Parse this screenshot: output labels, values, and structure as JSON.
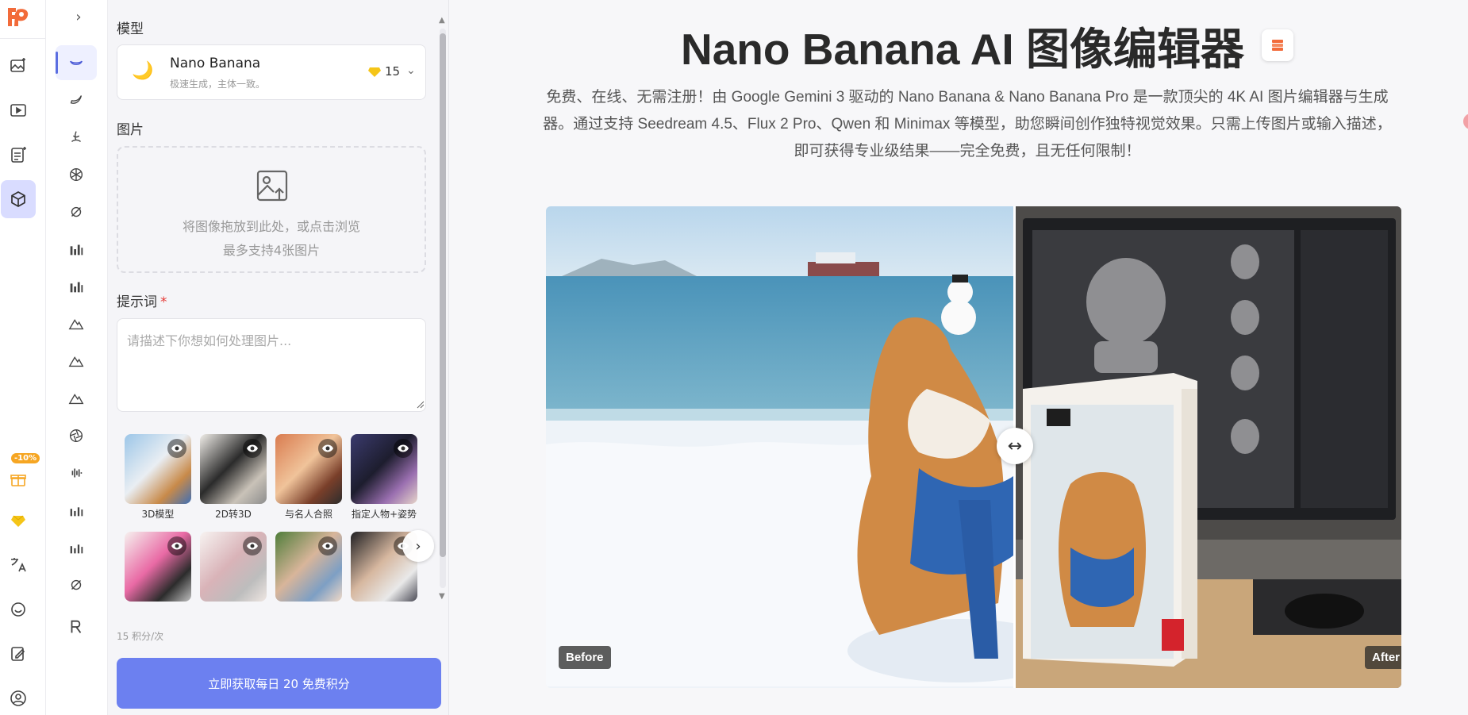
{
  "colors": {
    "accent": "#6c80f0",
    "brand": "#f26b3a",
    "active_rail": "#d9dcff",
    "discount_badge": "#f6a623",
    "coin": "#f5c518",
    "required": "#e53935"
  },
  "rail": {
    "items": [
      {
        "icon": "image-sparkle-icon"
      },
      {
        "icon": "video-play-icon"
      },
      {
        "icon": "document-sparkle-icon"
      },
      {
        "icon": "cube-3d-icon",
        "active": true
      }
    ],
    "bottom": [
      {
        "icon": "gift-icon",
        "badge": "-10%"
      },
      {
        "icon": "coin-icon"
      },
      {
        "icon": "translate-icon"
      },
      {
        "icon": "chat-support-icon"
      },
      {
        "icon": "edit-note-icon"
      },
      {
        "icon": "user-account-icon"
      }
    ]
  },
  "tools": {
    "collapse_icon": "chevron-right-icon",
    "items": [
      {
        "icon": "nano-banana-model-icon",
        "active": true
      },
      {
        "icon": "banana-icon"
      },
      {
        "icon": "seedream-icon"
      },
      {
        "icon": "openai-icon"
      },
      {
        "icon": "qwen-icon"
      },
      {
        "icon": "bars-chart-icon"
      },
      {
        "icon": "bars-chart-icon-2"
      },
      {
        "icon": "mountain-icon"
      },
      {
        "icon": "mountain-icon-2"
      },
      {
        "icon": "mountain-icon-3"
      },
      {
        "icon": "aperture-icon"
      },
      {
        "icon": "waveform-icon"
      },
      {
        "icon": "bars-chart-icon-3"
      },
      {
        "icon": "bars-chart-icon-4"
      },
      {
        "icon": "qwen-icon-2"
      },
      {
        "icon": "recraft-icon"
      }
    ]
  },
  "panel": {
    "model_label": "模型",
    "model": {
      "name": "Nano Banana",
      "desc": "极速生成，主体一致。",
      "cost": "15",
      "emoji": "🌙"
    },
    "image_label": "图片",
    "drop_line1": "将图像拖放到此处，或点击浏览",
    "drop_line2": "最多支持4张图片",
    "prompt_label": "提示词",
    "required_mark": "*",
    "prompt_placeholder": "请描述下你想如何处理图片...",
    "prompt_value": "",
    "presets": [
      {
        "caption": "3D模型",
        "palette": [
          "#9cc6e8",
          "#e9eef3",
          "#c88a4a",
          "#3f6fb5"
        ]
      },
      {
        "caption": "2D转3D",
        "palette": [
          "#f1eee9",
          "#2b2b2b",
          "#c9c2b8",
          "#8d8d8d"
        ]
      },
      {
        "caption": "与名人合照",
        "palette": [
          "#d97b4f",
          "#f0c39a",
          "#7a3f2a",
          "#2d2d2d"
        ]
      },
      {
        "caption": "指定人物+姿势",
        "palette": [
          "#3b3b6e",
          "#1d1d2e",
          "#9a6fb0",
          "#e7d5c9"
        ]
      },
      {
        "caption": "",
        "palette": [
          "#f6f2ef",
          "#e96aa5",
          "#2c2c2c",
          "#c0c0c0"
        ]
      },
      {
        "caption": "",
        "palette": [
          "#f7f3f1",
          "#d9b3b8",
          "#bdbdbd",
          "#efe6e2"
        ]
      },
      {
        "caption": "",
        "palette": [
          "#4f7d3a",
          "#d8b59a",
          "#7d9fc4",
          "#f1d9c7"
        ]
      },
      {
        "caption": "",
        "palette": [
          "#1f1f22",
          "#d6b79f",
          "#e9e9e9",
          "#4a4a55"
        ]
      }
    ],
    "credits_note": "15 积分/次",
    "cta_label": "立即获取每日 20 免费积分"
  },
  "main": {
    "title": "Nano Banana AI 图像编辑器",
    "description": "免费、在线、无需注册！由 Google Gemini 3 驱动的 Nano Banana & Nano Banana Pro 是一款顶尖的 4K AI 图片编辑器与生成器。通过支持 Seedream 4.5、Flux 2 Pro、Qwen 和 Minimax 等模型，助您瞬间创作独特视觉效果。只需上传图片或输入描述，即可获得专业级结果——完全免费，且无任何限制！",
    "before_label": "Before",
    "after_label": "After",
    "handle_glyph": "↔",
    "preset_next_glyph": "›"
  }
}
